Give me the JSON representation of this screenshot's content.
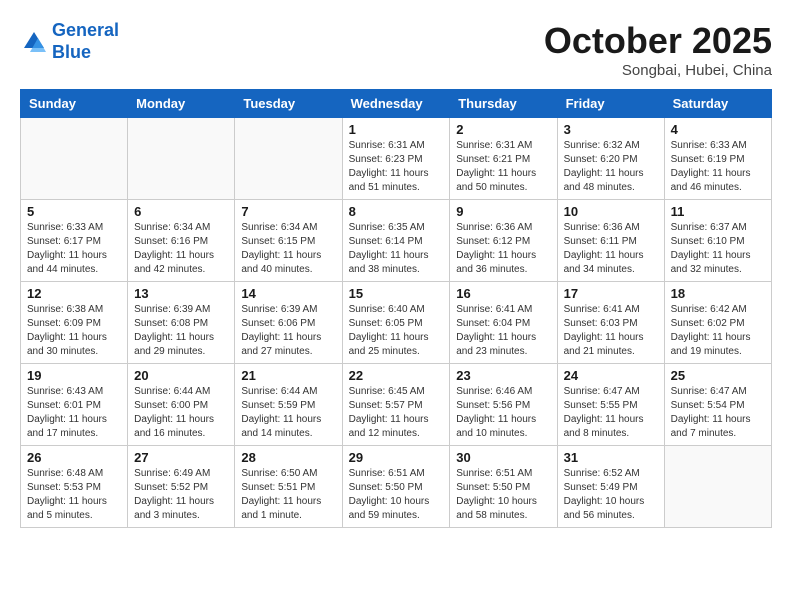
{
  "header": {
    "logo_line1": "General",
    "logo_line2": "Blue",
    "month": "October 2025",
    "location": "Songbai, Hubei, China"
  },
  "weekdays": [
    "Sunday",
    "Monday",
    "Tuesday",
    "Wednesday",
    "Thursday",
    "Friday",
    "Saturday"
  ],
  "weeks": [
    [
      {
        "day": "",
        "info": ""
      },
      {
        "day": "",
        "info": ""
      },
      {
        "day": "",
        "info": ""
      },
      {
        "day": "1",
        "info": "Sunrise: 6:31 AM\nSunset: 6:23 PM\nDaylight: 11 hours\nand 51 minutes."
      },
      {
        "day": "2",
        "info": "Sunrise: 6:31 AM\nSunset: 6:21 PM\nDaylight: 11 hours\nand 50 minutes."
      },
      {
        "day": "3",
        "info": "Sunrise: 6:32 AM\nSunset: 6:20 PM\nDaylight: 11 hours\nand 48 minutes."
      },
      {
        "day": "4",
        "info": "Sunrise: 6:33 AM\nSunset: 6:19 PM\nDaylight: 11 hours\nand 46 minutes."
      }
    ],
    [
      {
        "day": "5",
        "info": "Sunrise: 6:33 AM\nSunset: 6:17 PM\nDaylight: 11 hours\nand 44 minutes."
      },
      {
        "day": "6",
        "info": "Sunrise: 6:34 AM\nSunset: 6:16 PM\nDaylight: 11 hours\nand 42 minutes."
      },
      {
        "day": "7",
        "info": "Sunrise: 6:34 AM\nSunset: 6:15 PM\nDaylight: 11 hours\nand 40 minutes."
      },
      {
        "day": "8",
        "info": "Sunrise: 6:35 AM\nSunset: 6:14 PM\nDaylight: 11 hours\nand 38 minutes."
      },
      {
        "day": "9",
        "info": "Sunrise: 6:36 AM\nSunset: 6:12 PM\nDaylight: 11 hours\nand 36 minutes."
      },
      {
        "day": "10",
        "info": "Sunrise: 6:36 AM\nSunset: 6:11 PM\nDaylight: 11 hours\nand 34 minutes."
      },
      {
        "day": "11",
        "info": "Sunrise: 6:37 AM\nSunset: 6:10 PM\nDaylight: 11 hours\nand 32 minutes."
      }
    ],
    [
      {
        "day": "12",
        "info": "Sunrise: 6:38 AM\nSunset: 6:09 PM\nDaylight: 11 hours\nand 30 minutes."
      },
      {
        "day": "13",
        "info": "Sunrise: 6:39 AM\nSunset: 6:08 PM\nDaylight: 11 hours\nand 29 minutes."
      },
      {
        "day": "14",
        "info": "Sunrise: 6:39 AM\nSunset: 6:06 PM\nDaylight: 11 hours\nand 27 minutes."
      },
      {
        "day": "15",
        "info": "Sunrise: 6:40 AM\nSunset: 6:05 PM\nDaylight: 11 hours\nand 25 minutes."
      },
      {
        "day": "16",
        "info": "Sunrise: 6:41 AM\nSunset: 6:04 PM\nDaylight: 11 hours\nand 23 minutes."
      },
      {
        "day": "17",
        "info": "Sunrise: 6:41 AM\nSunset: 6:03 PM\nDaylight: 11 hours\nand 21 minutes."
      },
      {
        "day": "18",
        "info": "Sunrise: 6:42 AM\nSunset: 6:02 PM\nDaylight: 11 hours\nand 19 minutes."
      }
    ],
    [
      {
        "day": "19",
        "info": "Sunrise: 6:43 AM\nSunset: 6:01 PM\nDaylight: 11 hours\nand 17 minutes."
      },
      {
        "day": "20",
        "info": "Sunrise: 6:44 AM\nSunset: 6:00 PM\nDaylight: 11 hours\nand 16 minutes."
      },
      {
        "day": "21",
        "info": "Sunrise: 6:44 AM\nSunset: 5:59 PM\nDaylight: 11 hours\nand 14 minutes."
      },
      {
        "day": "22",
        "info": "Sunrise: 6:45 AM\nSunset: 5:57 PM\nDaylight: 11 hours\nand 12 minutes."
      },
      {
        "day": "23",
        "info": "Sunrise: 6:46 AM\nSunset: 5:56 PM\nDaylight: 11 hours\nand 10 minutes."
      },
      {
        "day": "24",
        "info": "Sunrise: 6:47 AM\nSunset: 5:55 PM\nDaylight: 11 hours\nand 8 minutes."
      },
      {
        "day": "25",
        "info": "Sunrise: 6:47 AM\nSunset: 5:54 PM\nDaylight: 11 hours\nand 7 minutes."
      }
    ],
    [
      {
        "day": "26",
        "info": "Sunrise: 6:48 AM\nSunset: 5:53 PM\nDaylight: 11 hours\nand 5 minutes."
      },
      {
        "day": "27",
        "info": "Sunrise: 6:49 AM\nSunset: 5:52 PM\nDaylight: 11 hours\nand 3 minutes."
      },
      {
        "day": "28",
        "info": "Sunrise: 6:50 AM\nSunset: 5:51 PM\nDaylight: 11 hours\nand 1 minute."
      },
      {
        "day": "29",
        "info": "Sunrise: 6:51 AM\nSunset: 5:50 PM\nDaylight: 10 hours\nand 59 minutes."
      },
      {
        "day": "30",
        "info": "Sunrise: 6:51 AM\nSunset: 5:50 PM\nDaylight: 10 hours\nand 58 minutes."
      },
      {
        "day": "31",
        "info": "Sunrise: 6:52 AM\nSunset: 5:49 PM\nDaylight: 10 hours\nand 56 minutes."
      },
      {
        "day": "",
        "info": ""
      }
    ]
  ]
}
